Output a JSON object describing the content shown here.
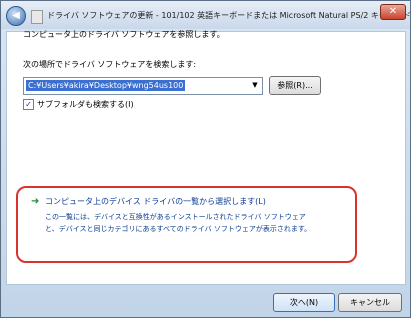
{
  "window": {
    "title": "ドライバ ソフトウェアの更新 - 101/102 英語キーボードまたは Microsoft Natural PS/2 キーボード",
    "close_label": "✕",
    "back_label": "◀"
  },
  "content": {
    "heading": "コンピュータ上のドライバ ソフトウェアを参照します。",
    "search_label": "次の場所でドライバ ソフトウェアを検索します:",
    "path_value": "C:¥Users¥akira¥Desktop¥wng54us100",
    "combo_arrow": "▼",
    "browse_label": "参照(R)...",
    "checkbox_mark": "✓",
    "subfolder_label": "サブフォルダも検索する(I)",
    "pick_arrow": "➜",
    "pick_title": "コンピュータ上のデバイス ドライバの一覧から選択します(L)",
    "pick_desc_line1": "この一覧には、デバイスと互換性があるインストールされたドライバ ソフトウェア",
    "pick_desc_line2": "と、デバイスと同じカテゴリにあるすべてのドライバ ソフトウェアが表示されます。"
  },
  "footer": {
    "next_label": "次へ(N)",
    "cancel_label": "キャンセル"
  },
  "colors": {
    "highlight_frame": "#d9342b",
    "link_text": "#0a3d91",
    "selection": "#3b6fd1"
  }
}
